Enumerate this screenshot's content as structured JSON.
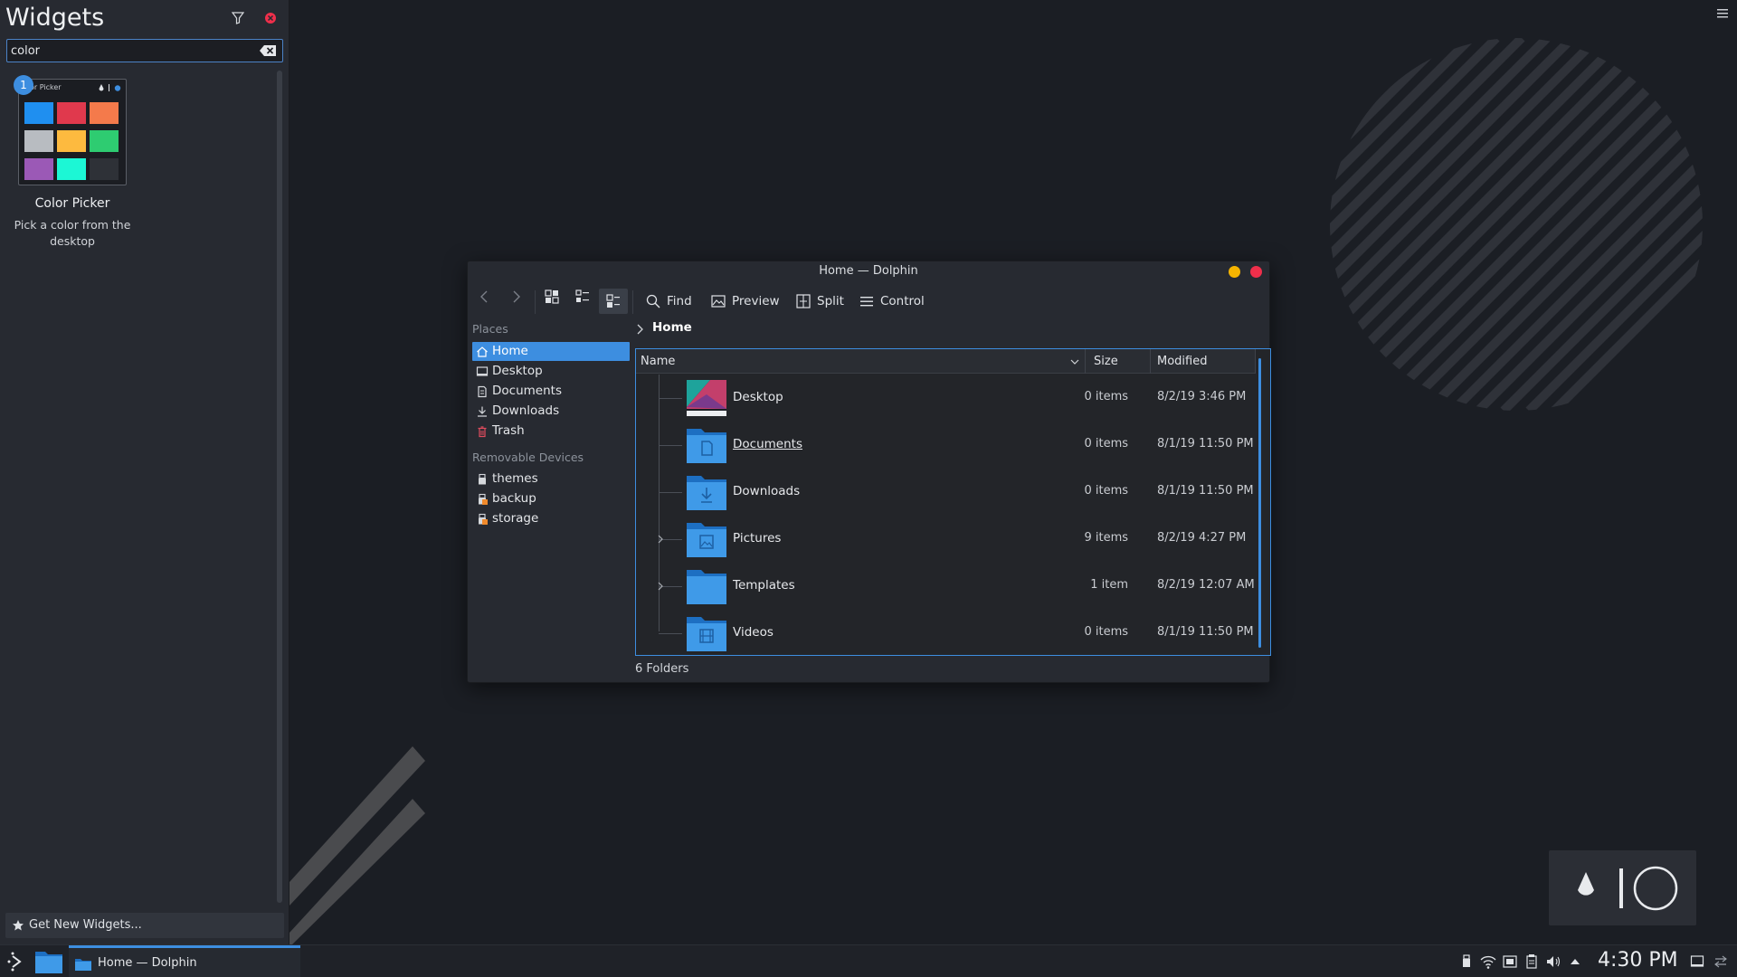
{
  "widgets_panel": {
    "title": "Widgets",
    "search_value": "color",
    "badge_count": "1",
    "tile_header": "or Picker",
    "widget_name": "Color Picker",
    "widget_description": "Pick a color from the desktop",
    "get_new_label": "Get New Widgets..."
  },
  "swatches": [
    "#1f8ff0",
    "#e0394d",
    "#f47a4b",
    "#b8bcc1",
    "#fdba3f",
    "#2ecc71",
    "#9b59b6",
    "#1cf7d5",
    "#2e3137"
  ],
  "dolphin": {
    "title": "Home — Dolphin",
    "toolbar": {
      "find": "Find",
      "preview": "Preview",
      "split": "Split",
      "control": "Control"
    },
    "places_header": "Places",
    "places": [
      "Home",
      "Desktop",
      "Documents",
      "Downloads",
      "Trash"
    ],
    "removable_header": "Removable Devices",
    "devices": [
      "themes",
      "backup",
      "storage"
    ],
    "breadcrumb": "Home",
    "columns": {
      "name": "Name",
      "size": "Size",
      "modified": "Modified"
    },
    "files": [
      {
        "name": "Desktop",
        "size": "0 items",
        "modified": "8/2/19 3:46 PM"
      },
      {
        "name": "Documents",
        "size": "0 items",
        "modified": "8/1/19 11:50 PM"
      },
      {
        "name": "Downloads",
        "size": "0 items",
        "modified": "8/1/19 11:50 PM"
      },
      {
        "name": "Pictures",
        "size": "9 items",
        "modified": "8/2/19 4:27 PM"
      },
      {
        "name": "Templates",
        "size": "1 item",
        "modified": "8/2/19 12:07 AM"
      },
      {
        "name": "Videos",
        "size": "0 items",
        "modified": "8/1/19 11:50 PM"
      }
    ],
    "status": "6 Folders"
  },
  "taskbar": {
    "task_label": "Home — Dolphin",
    "clock": "4:30 PM"
  },
  "colors": {
    "accent": "#3d8ee0",
    "minimize": "#f5b400",
    "close": "#ef2f4b"
  }
}
